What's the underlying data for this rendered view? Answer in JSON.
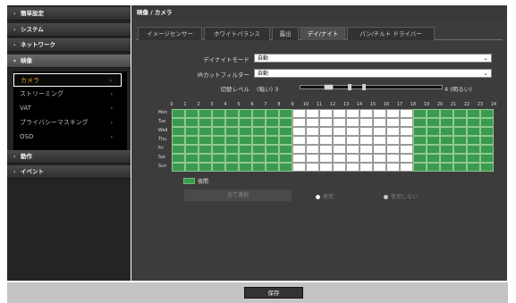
{
  "sidebar": {
    "categories": [
      {
        "label": "簡単設定"
      },
      {
        "label": "システム"
      },
      {
        "label": "ネットワーク"
      },
      {
        "label": "映像"
      },
      {
        "label": "動作"
      },
      {
        "label": "イベント"
      }
    ],
    "video_items": [
      {
        "label": "カメラ"
      },
      {
        "label": "ストリーミング"
      },
      {
        "label": "VAT"
      },
      {
        "label": "プライバシーマスキング"
      },
      {
        "label": "OSD"
      }
    ]
  },
  "header": {
    "title": "映像 / カメラ"
  },
  "tabs": [
    {
      "label": "イメージセンサー"
    },
    {
      "label": "ホワイトバランス"
    },
    {
      "label": "露出"
    },
    {
      "label": "デイ/ナイト"
    },
    {
      "label": "パン/チルト ドライバー"
    }
  ],
  "form": {
    "day_night_mode": {
      "label": "デイナイトモード",
      "value": "自動"
    },
    "ir_filter": {
      "label": "IRカットフィルター",
      "value": "自動"
    },
    "switch_level": {
      "label": "切替レベル",
      "left_text": "(暗い)",
      "min": "3",
      "max": "4",
      "right_text": "(明るい)",
      "value_fraction": 0.2
    }
  },
  "schedule": {
    "hours": [
      "0",
      "1",
      "2",
      "3",
      "4",
      "5",
      "6",
      "7",
      "8",
      "9",
      "10",
      "11",
      "12",
      "13",
      "14",
      "15",
      "16",
      "17",
      "18",
      "19",
      "20",
      "21",
      "22",
      "23",
      "24"
    ],
    "days": [
      "Mon",
      "Tue",
      "Wed",
      "Thu",
      "Fri",
      "Sat",
      "Sun"
    ],
    "night_hours": [
      0,
      1,
      2,
      3,
      4,
      5,
      6,
      7,
      8,
      18,
      19,
      20,
      21,
      22,
      23
    ],
    "colors": {
      "night": "#3a9a4e",
      "day": "#ffffff"
    }
  },
  "legend": {
    "label": "夜間"
  },
  "actions": {
    "select_all": "全て選択",
    "use": "使用",
    "not_use": "使用しない"
  },
  "footer": {
    "save": "保存"
  }
}
